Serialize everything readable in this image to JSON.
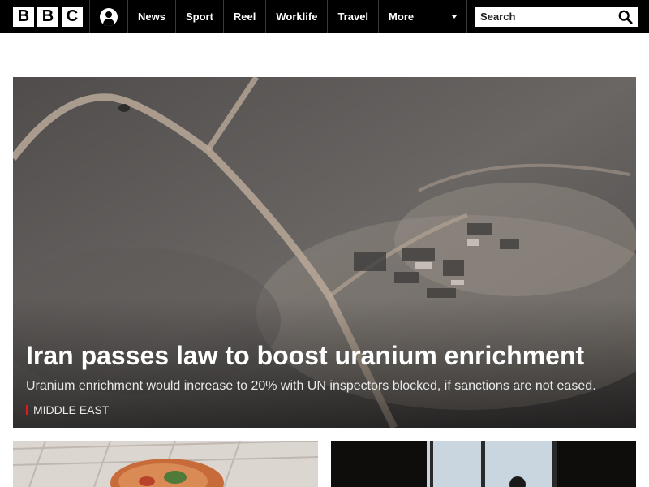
{
  "brand": {
    "letters": [
      "B",
      "B",
      "C"
    ]
  },
  "nav": {
    "items": [
      {
        "label": "News"
      },
      {
        "label": "Sport"
      },
      {
        "label": "Reel"
      },
      {
        "label": "Worklife"
      },
      {
        "label": "Travel"
      }
    ],
    "more_label": "More"
  },
  "search": {
    "placeholder": "Search"
  },
  "hero": {
    "title": "Iran passes law to boost uranium enrichment",
    "summary": "Uranium enrichment would increase to 20% with UN inspectors blocked, if sanctions are not eased.",
    "tag": "MIDDLE EAST"
  },
  "colors": {
    "nav_bg": "#000000",
    "tag_accent": "#e0191b"
  }
}
